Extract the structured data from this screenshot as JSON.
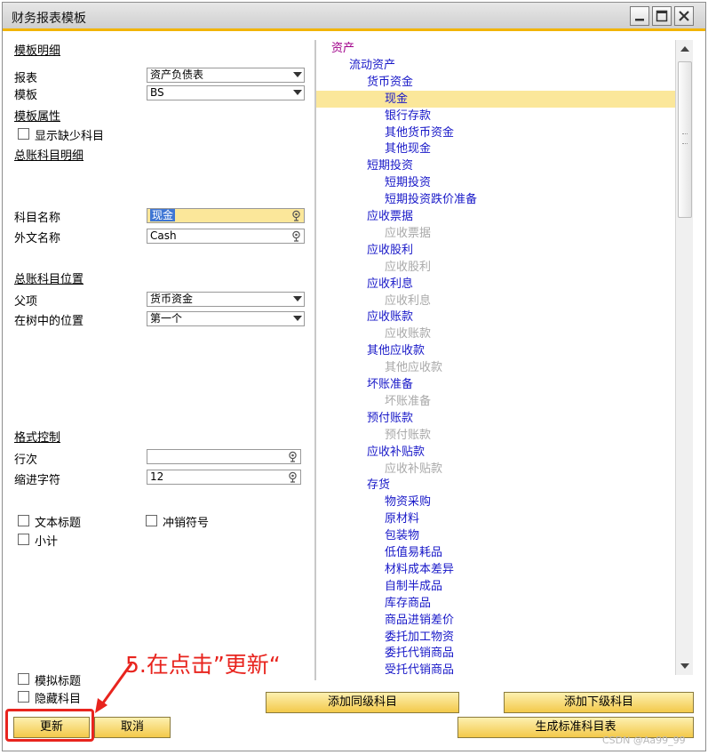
{
  "window": {
    "title": "财务报表模板"
  },
  "left": {
    "section_template_detail": "模板明细",
    "label_report": "报表",
    "report_value": "资产负债表",
    "label_template": "模板",
    "template_value": "BS",
    "section_template_attr": "模板属性",
    "show_missing_label": "显示缺少科目",
    "section_gl_detail": "总账科目明细",
    "label_account_name": "科目名称",
    "account_name_value": "现金",
    "label_foreign_name": "外文名称",
    "foreign_name_value": "Cash",
    "section_gl_position": "总账科目位置",
    "label_parent": "父项",
    "parent_value": "货币资金",
    "label_tree_pos": "在树中的位置",
    "tree_pos_value": "第一个",
    "section_format": "格式控制",
    "label_row_spacing": "行次",
    "row_spacing_value": "",
    "label_indent": "缩进字符",
    "indent_value": "12",
    "cb_text_title": "文本标题",
    "cb_offset_sign": "冲销符号",
    "cb_subtotal": "小计",
    "cb_dummy_title": "模拟标题",
    "cb_hide_account": "隐藏科目"
  },
  "tree": {
    "nodes": [
      {
        "text": "资产",
        "indent": 0,
        "style": "root"
      },
      {
        "text": "流动资产",
        "indent": 1,
        "style": "normal"
      },
      {
        "text": "货币资金",
        "indent": 2,
        "style": "normal"
      },
      {
        "text": "现金",
        "indent": 3,
        "style": "normal"
      },
      {
        "text": "银行存款",
        "indent": 3,
        "style": "normal"
      },
      {
        "text": "其他货币资金",
        "indent": 3,
        "style": "normal"
      },
      {
        "text": "其他现金",
        "indent": 3,
        "style": "normal"
      },
      {
        "text": "短期投资",
        "indent": 2,
        "style": "normal"
      },
      {
        "text": "短期投资",
        "indent": 3,
        "style": "normal"
      },
      {
        "text": "短期投资跌价准备",
        "indent": 3,
        "style": "normal"
      },
      {
        "text": "应收票据",
        "indent": 2,
        "style": "normal"
      },
      {
        "text": "应收票据",
        "indent": 3,
        "style": "dim"
      },
      {
        "text": "应收股利",
        "indent": 2,
        "style": "normal"
      },
      {
        "text": "应收股利",
        "indent": 3,
        "style": "dim"
      },
      {
        "text": "应收利息",
        "indent": 2,
        "style": "normal"
      },
      {
        "text": "应收利息",
        "indent": 3,
        "style": "dim"
      },
      {
        "text": "应收账款",
        "indent": 2,
        "style": "normal"
      },
      {
        "text": "应收账款",
        "indent": 3,
        "style": "dim"
      },
      {
        "text": "其他应收款",
        "indent": 2,
        "style": "normal"
      },
      {
        "text": "其他应收款",
        "indent": 3,
        "style": "dim"
      },
      {
        "text": "坏账准备",
        "indent": 2,
        "style": "normal"
      },
      {
        "text": "坏账准备",
        "indent": 3,
        "style": "dim"
      },
      {
        "text": "预付账款",
        "indent": 2,
        "style": "normal"
      },
      {
        "text": "预付账款",
        "indent": 3,
        "style": "dim"
      },
      {
        "text": "应收补贴款",
        "indent": 2,
        "style": "normal"
      },
      {
        "text": "应收补贴款",
        "indent": 3,
        "style": "dim"
      },
      {
        "text": "存货",
        "indent": 2,
        "style": "normal"
      },
      {
        "text": "物资采购",
        "indent": 3,
        "style": "normal"
      },
      {
        "text": "原材料",
        "indent": 3,
        "style": "normal"
      },
      {
        "text": "包装物",
        "indent": 3,
        "style": "normal"
      },
      {
        "text": "低值易耗品",
        "indent": 3,
        "style": "normal"
      },
      {
        "text": "材料成本差异",
        "indent": 3,
        "style": "normal"
      },
      {
        "text": "自制半成品",
        "indent": 3,
        "style": "normal"
      },
      {
        "text": "库存商品",
        "indent": 3,
        "style": "normal"
      },
      {
        "text": "商品进销差价",
        "indent": 3,
        "style": "normal"
      },
      {
        "text": "委托加工物资",
        "indent": 3,
        "style": "normal"
      },
      {
        "text": "委托代销商品",
        "indent": 3,
        "style": "normal"
      },
      {
        "text": "受托代销商品",
        "indent": 3,
        "style": "normal"
      }
    ],
    "selected_index": 3
  },
  "buttons": {
    "update": "更新",
    "cancel": "取消",
    "add_sibling": "添加同级科目",
    "add_child": "添加下级科目",
    "generate": "生成标准科目表"
  },
  "annotation": {
    "text": "5.在点击”更新“",
    "color": "#e8241e"
  },
  "watermark": "CSDN @Aa99_99",
  "colors": {
    "accent": "#f1b400",
    "tree_link": "#1818c8",
    "tree_root": "#a0008a",
    "tree_dim": "#a9a9a9",
    "highlight": "#fbe79a"
  }
}
